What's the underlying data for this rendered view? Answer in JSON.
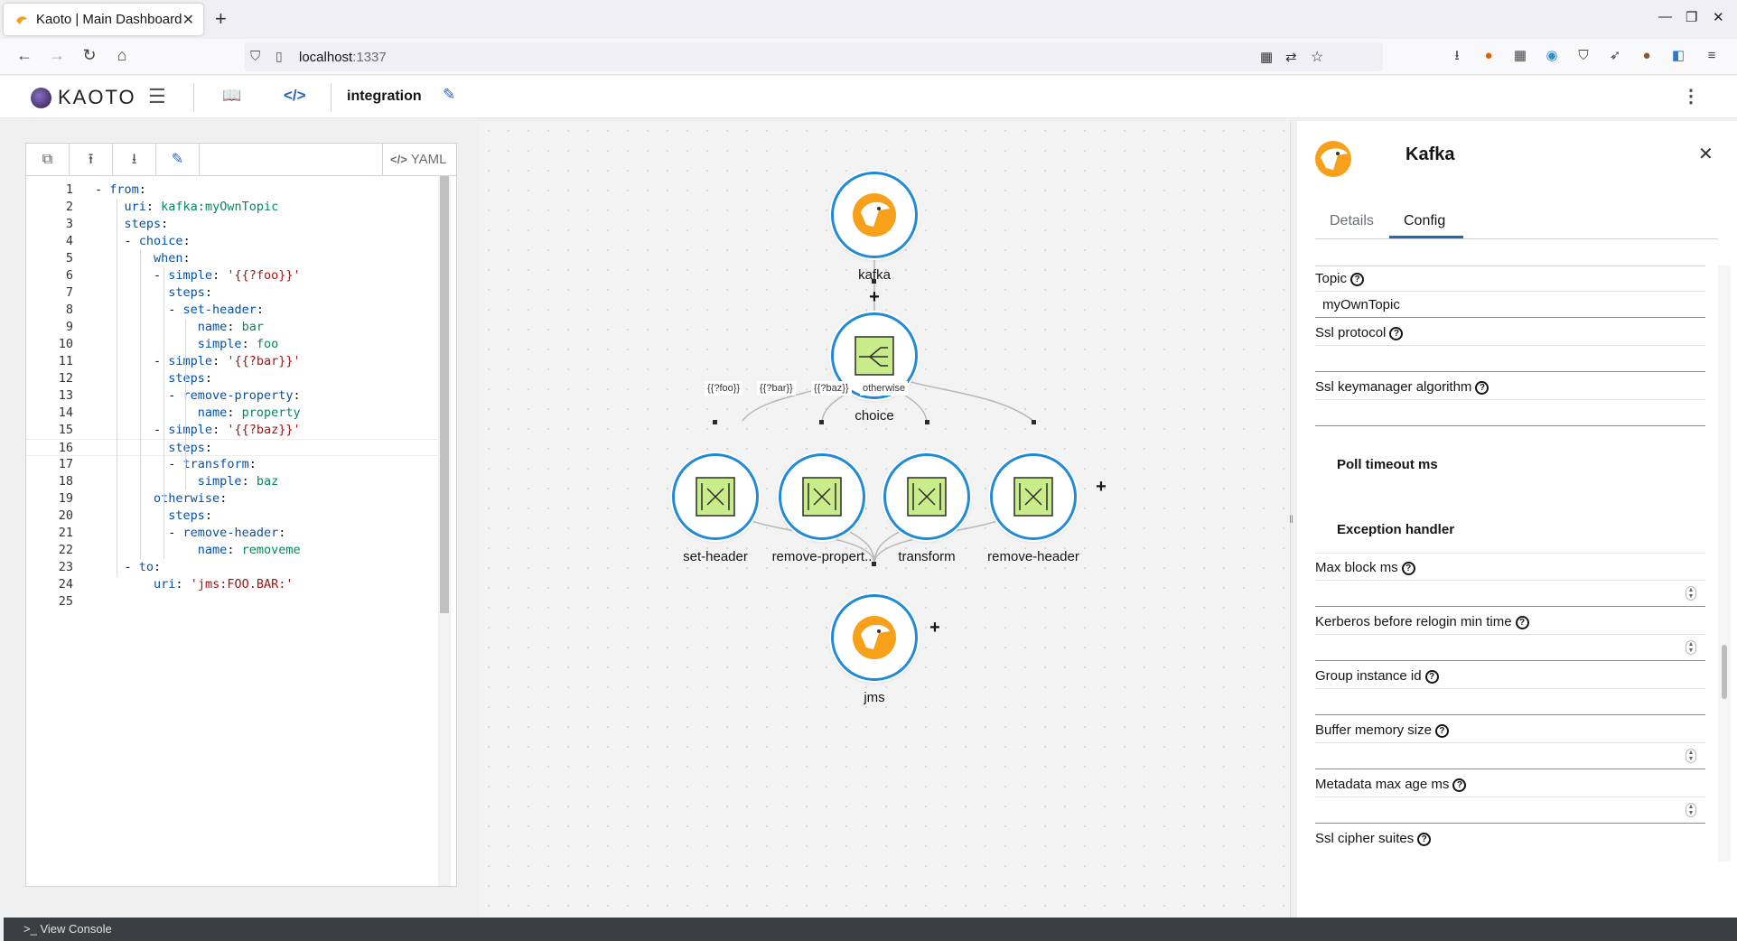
{
  "browser": {
    "tab_title": "Kaoto | Main Dashboard",
    "url_host": "localhost",
    "url_port": ":1337",
    "tab_close": "✕",
    "new_tab": "+"
  },
  "app": {
    "brand": "KAOTO",
    "integration_name": "integration"
  },
  "editor": {
    "yaml_tab": "YAML",
    "lines": [
      "- from:",
      "    uri: kafka:myOwnTopic",
      "    steps:",
      "    - choice:",
      "        when:",
      "        - simple: '{{?foo}}'",
      "          steps:",
      "          - set-header:",
      "              name: bar",
      "              simple: foo",
      "        - simple: '{{?bar}}'",
      "          steps:",
      "          - remove-property:",
      "              name: property",
      "        - simple: '{{?baz}}'",
      "          steps:",
      "          - transform:",
      "              simple: baz",
      "        otherwise:",
      "          steps:",
      "          - remove-header:",
      "              name: removeme",
      "    - to:",
      "        uri: 'jms:FOO.BAR:'",
      ""
    ],
    "active_line": 16
  },
  "flow": {
    "nodes": {
      "kafka": "kafka",
      "choice": "choice",
      "set_header": "set-header",
      "remove_property": "remove-propert..",
      "transform": "transform",
      "remove_header": "remove-header",
      "jms": "jms"
    },
    "edges": {
      "foo": "{{?foo}}",
      "bar": "{{?bar}}",
      "baz": "{{?baz}}",
      "otherwise": "otherwise"
    },
    "plus": "+"
  },
  "details": {
    "title": "Kafka",
    "tabs": [
      "Details",
      "Config"
    ],
    "active_tab": "Config",
    "fields": {
      "topic_label": "Topic",
      "topic_value": "myOwnTopic",
      "ssl_protocol": "Ssl protocol",
      "ssl_keymanager": "Ssl keymanager algorithm",
      "poll_timeout": "Poll timeout ms",
      "exception_handler": "Exception handler",
      "max_block": "Max block ms",
      "kerberos": "Kerberos before relogin min time",
      "group_instance": "Group instance id",
      "buffer_memory": "Buffer memory size",
      "metadata_max_age": "Metadata max age ms",
      "ssl_cipher": "Ssl cipher suites"
    }
  },
  "console": {
    "label": "View Console"
  },
  "colors": {
    "accent": "#2b63b8",
    "node_border": "#1f8ad6",
    "eip_green": "#c8ec8a"
  }
}
